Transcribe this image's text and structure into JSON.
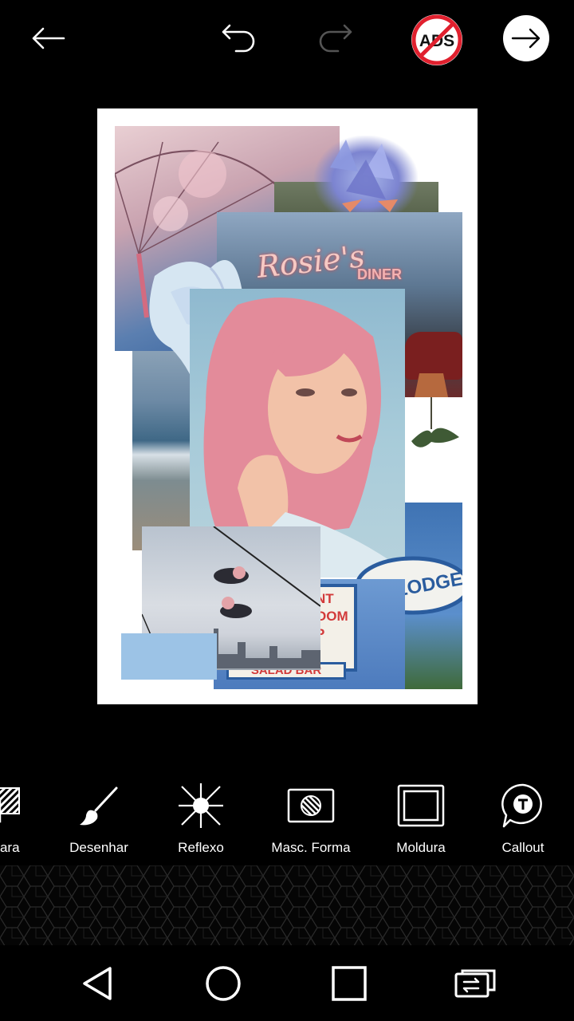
{
  "topbar": {
    "back_icon": "arrow-left-icon",
    "undo_icon": "undo-icon",
    "redo_icon": "redo-icon",
    "noads_label": "ADS",
    "next_icon": "arrow-right-icon"
  },
  "canvas": {
    "sign_rosies": "Rosie's",
    "sign_diner": "DINER",
    "sign_lodge": "GE LODGE",
    "sign_salad": "SALAD BAR",
    "sign_room": "NT\nOOM\nP"
  },
  "tools": [
    {
      "label": "cara",
      "icon": "mask-icon"
    },
    {
      "label": "Desenhar",
      "icon": "brush-icon"
    },
    {
      "label": "Reflexo",
      "icon": "lens-flare-icon"
    },
    {
      "label": "Masc. Forma",
      "icon": "shape-mask-icon"
    },
    {
      "label": "Moldura",
      "icon": "frame-icon"
    },
    {
      "label": "Callout",
      "icon": "callout-icon"
    }
  ],
  "navbar": {
    "back": "nav-back-icon",
    "home": "nav-home-icon",
    "recents": "nav-recents-icon",
    "switch": "nav-switch-icon"
  },
  "colors": {
    "background": "#000000",
    "noads_red": "#e0202e",
    "text": "#ffffff"
  }
}
